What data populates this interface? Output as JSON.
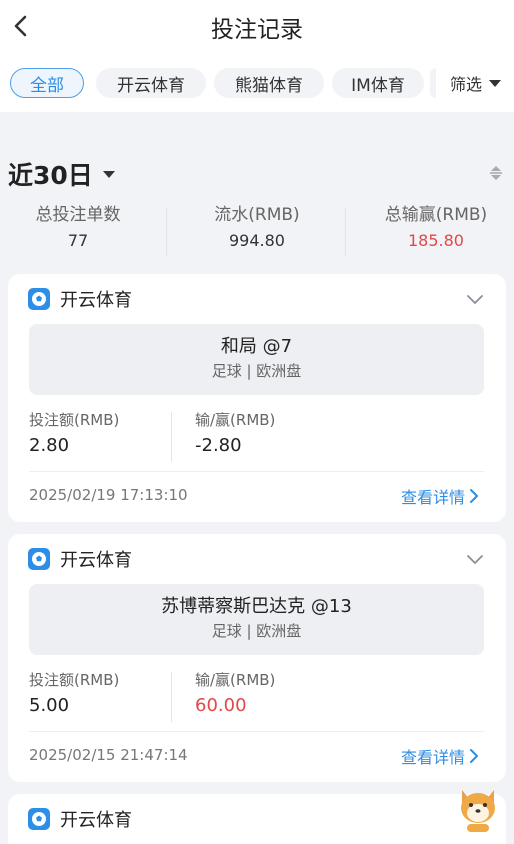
{
  "header": {
    "title": "投注记录",
    "back_icon": "chevron-left-icon"
  },
  "tabs": [
    {
      "label": "全部",
      "active": true
    },
    {
      "label": "开云体育",
      "active": false
    },
    {
      "label": "熊猫体育",
      "active": false
    },
    {
      "label": "IM体育",
      "active": false
    }
  ],
  "filter": {
    "label": "筛选",
    "icon": "caret-down-icon"
  },
  "period": {
    "label": "近30日"
  },
  "stats": [
    {
      "label": "总投注单数",
      "value": "77"
    },
    {
      "label": "流水(RMB)",
      "value": "994.80"
    },
    {
      "label": "总输赢(RMB)",
      "value": "185.80",
      "color": "#e24848"
    }
  ],
  "bets": [
    {
      "vendor": "开云体育",
      "pick": "和局 @7",
      "detail": "足球 | 欧洲盘",
      "stake_label": "投注额(RMB)",
      "stake": "2.80",
      "result_label": "输/赢(RMB)",
      "result": "-2.80",
      "time": "2025/02/19 17:13:10",
      "link": "查看详情"
    },
    {
      "vendor": "开云体育",
      "pick": "苏博蒂察斯巴达克 @13",
      "detail": "足球 | 欧洲盘",
      "stake_label": "投注额(RMB)",
      "stake": "5.00",
      "result_label": "输/赢(RMB)",
      "result": "60.00",
      "result_color": "#e24848",
      "time": "2025/02/15 21:47:14",
      "link": "查看详情"
    },
    {
      "vendor": "开云体育"
    }
  ],
  "colors": {
    "accent": "#2c8ee6",
    "win": "#e24848",
    "page_bg": "#f2f3f7"
  }
}
